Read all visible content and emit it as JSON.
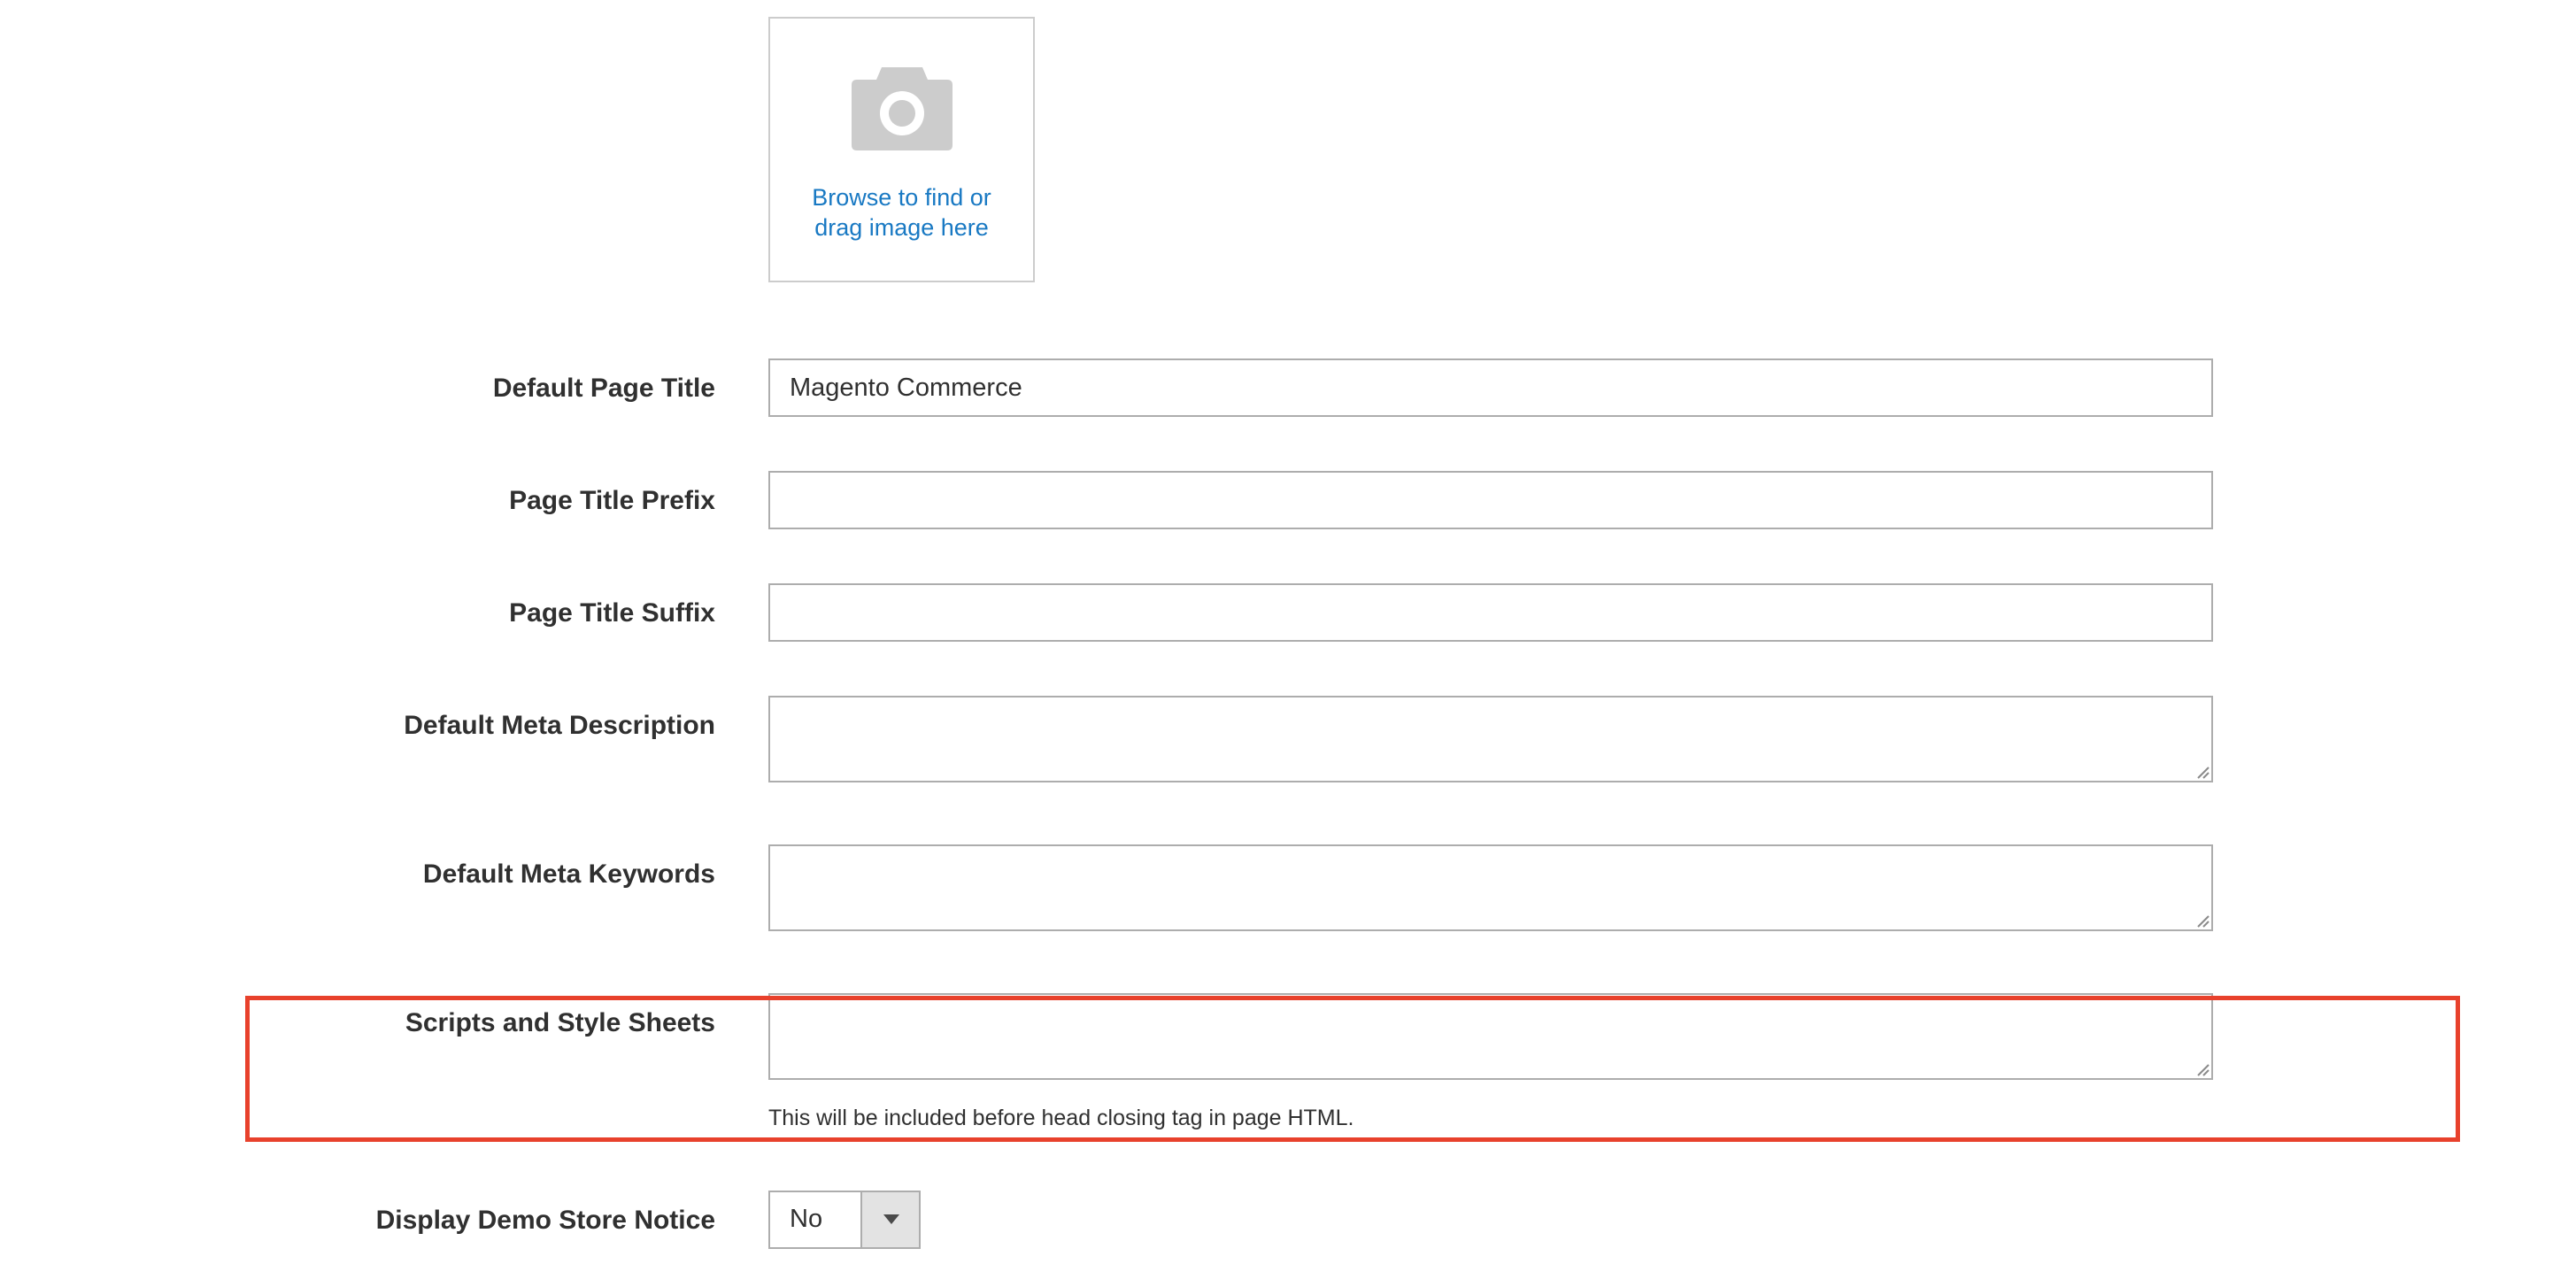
{
  "uploader": {
    "icon": "camera-icon",
    "line1": "Browse to find or",
    "line2": "drag image here"
  },
  "fields": {
    "default_page_title": {
      "label": "Default Page Title",
      "value": "Magento Commerce"
    },
    "page_title_prefix": {
      "label": "Page Title Prefix",
      "value": ""
    },
    "page_title_suffix": {
      "label": "Page Title Suffix",
      "value": ""
    },
    "default_meta_description": {
      "label": "Default Meta Description",
      "value": ""
    },
    "default_meta_keywords": {
      "label": "Default Meta Keywords",
      "value": ""
    },
    "scripts_and_style_sheets": {
      "label": "Scripts and Style Sheets",
      "value": "",
      "note": "This will be included before head closing tag in page HTML."
    },
    "display_demo_store_notice": {
      "label": "Display Demo Store Notice",
      "selected": "No"
    }
  },
  "colors": {
    "link": "#1979c3",
    "highlight": "#e8412c",
    "border": "#adadad"
  }
}
